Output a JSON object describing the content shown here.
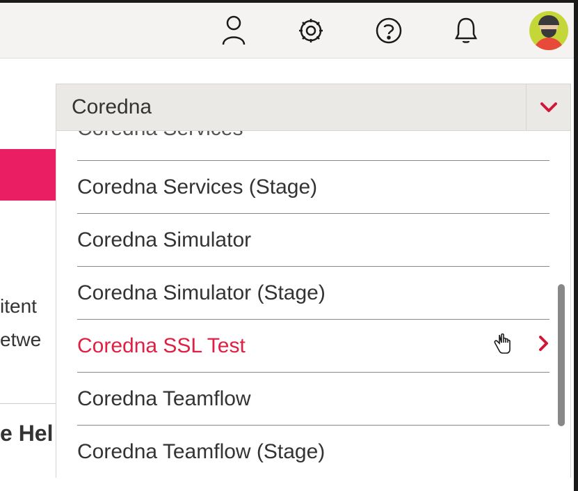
{
  "colors": {
    "accent": "#e02043",
    "pink": "#e91e63",
    "avatar_bg": "#c5d639"
  },
  "topbar": {
    "icons": [
      "person",
      "gear",
      "help",
      "bell"
    ]
  },
  "background": {
    "line1": "itent",
    "line2": "etwe",
    "helpful": "e Hel"
  },
  "dropdown": {
    "selected": "Coredna",
    "items": [
      {
        "label": "Coredna Services",
        "clipped": true
      },
      {
        "label": "Coredna Services (Stage)"
      },
      {
        "label": "Coredna Simulator"
      },
      {
        "label": "Coredna Simulator (Stage)"
      },
      {
        "label": "Coredna SSL Test",
        "highlighted": true
      },
      {
        "label": "Coredna Teamflow"
      },
      {
        "label": "Coredna Teamflow (Stage)"
      }
    ]
  }
}
